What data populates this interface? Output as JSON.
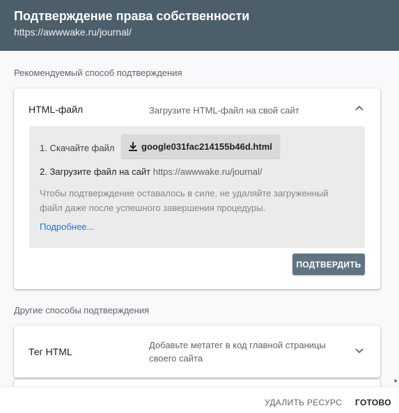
{
  "header": {
    "title": "Подтверждение права собственности",
    "url": "https://awwwake.ru/journal/"
  },
  "recommended": {
    "section_label": "Рекомендуемый способ подтверждения",
    "method": "HTML-файл",
    "description": "Загрузите HTML-файл на свой сайт",
    "step1_label": "1. Скачайте файл",
    "download_file": "google031fac214155b46d.html",
    "step2_label": "2. Загрузите файл на сайт",
    "step2_url": "https://awwwake.ru/journal/",
    "note": "Чтобы подтверждение оставалось в силе, не удаляйте загруженный файл даже после успешного завершения процедуры.",
    "more_link": "Подробнее...",
    "confirm_button": "ПОДТВЕРДИТЬ",
    "expand_icon": "chevron-up-icon"
  },
  "other": {
    "section_label": "Другие способы подтверждения",
    "method": "Тег HTML",
    "description": "Добавьте метатег в код главной страницы своего сайта",
    "expand_icon": "chevron-down-icon"
  },
  "footer": {
    "delete_label": "УДАЛИТЬ РЕСУРС",
    "done_label": "ГОТОВО"
  },
  "colors": {
    "header_bg": "#4c5e6a",
    "confirm_bg": "#5f7480",
    "link": "#1a73e8"
  }
}
